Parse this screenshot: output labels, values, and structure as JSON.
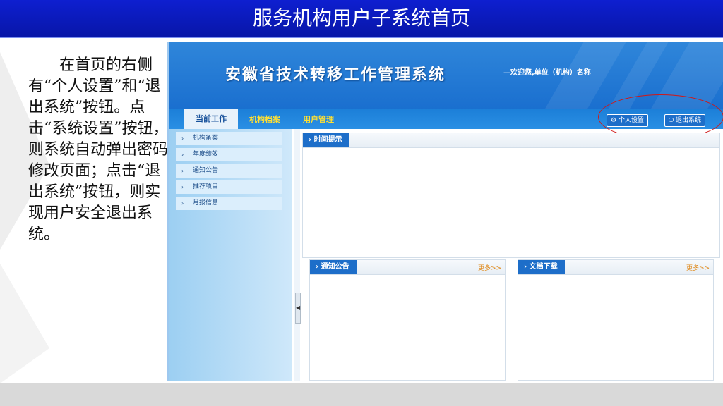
{
  "slide": {
    "title": "服务机构用户子系统首页",
    "description": "在首页的右侧有“个人设置”和“退出系统”按钮。点击“系统设置”按钮，则系统自动弹出密码修改页面；点击“退出系统”按钮，则实现用户安全退出系统。"
  },
  "app": {
    "title": "安徽省技术转移工作管理系统",
    "welcome": "—欢迎您,单位（机构）名称",
    "nav": {
      "current": "当前工作",
      "archive": "机构档案",
      "users": "用户管理"
    },
    "buttons": {
      "personal": "个人设置",
      "logout": "退出系统"
    },
    "sidebar": {
      "items": [
        {
          "label": "机构备案"
        },
        {
          "label": "年度绩效"
        },
        {
          "label": "通知公告"
        },
        {
          "label": "推荐项目"
        },
        {
          "label": "月报信息"
        }
      ]
    },
    "panels": {
      "time": {
        "title": "时间提示"
      },
      "notice": {
        "title": "通知公告",
        "more": "更多>>"
      },
      "docs": {
        "title": "文档下载",
        "more": "更多>>"
      }
    }
  },
  "colors": {
    "title_bar": "#0e1fd0",
    "accent": "#1d6ec9",
    "highlight_ellipse": "#d01818",
    "nav_active_text": "#ffe033"
  },
  "icons": {
    "personal": "gear-icon",
    "logout": "power-icon",
    "sidebar": "chevron-right-icon"
  }
}
